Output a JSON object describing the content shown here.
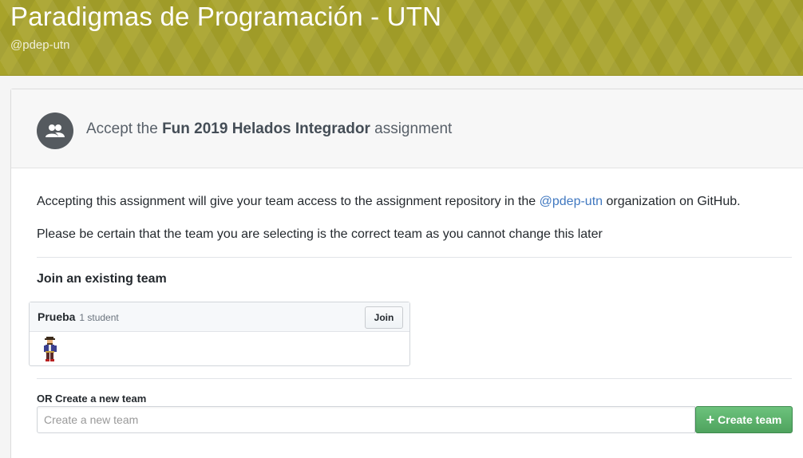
{
  "banner": {
    "title": "Paradigmas de Programación - UTN",
    "handle": "@pdep-utn"
  },
  "header": {
    "prefix": "Accept the",
    "assignment_name": "Fun 2019 Helados Integrador",
    "suffix": "assignment",
    "icon": "team-icon"
  },
  "body": {
    "access_text_before": "Accepting this assignment will give your team access to the assignment repository in the",
    "org_link": "@pdep-utn",
    "access_text_after": "organization on GitHub.",
    "warning_text": "Please be certain that the team you are selecting is the correct team as you cannot change this later"
  },
  "join": {
    "section_title": "Join an existing team",
    "teams": [
      {
        "name": "Prueba",
        "count": "1 student",
        "join_label": "Join",
        "member_icon": "pirate-avatar"
      }
    ]
  },
  "create": {
    "label": "OR Create a new team",
    "placeholder": "Create a new team",
    "button_label": "Create team",
    "button_icon": "plus-icon"
  },
  "colors": {
    "banner": "#a8a32a",
    "link": "#4078c0",
    "create_button": "#56ab66"
  }
}
